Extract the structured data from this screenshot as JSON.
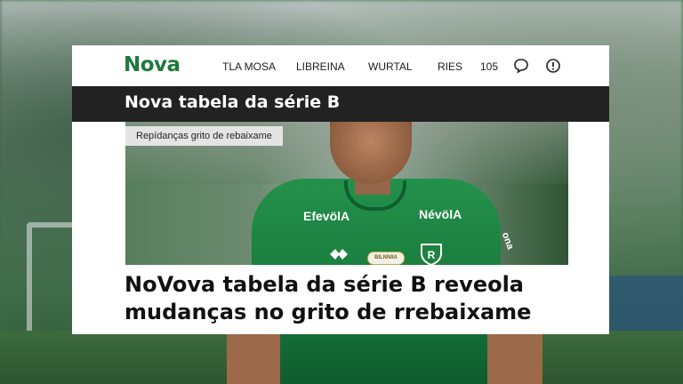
{
  "brand": {
    "logo": "Nova",
    "accent": "#1f7a3c"
  },
  "nav": {
    "items": [
      "TLA MOSA",
      "LIBREINA",
      "WURTAL",
      "RIES",
      "105"
    ],
    "icons": [
      "chat-icon",
      "alert-icon"
    ]
  },
  "section_title": "Nova tabela da série B",
  "tag": "Repídanças grito de rebaixame",
  "hero": {
    "sponsor_left": "EfevölA",
    "sponsor_right": "NévölA",
    "sleeve_text": "ona",
    "badge": "BILNNIIA"
  },
  "headline": {
    "line1": "NoVova tabela da série B reveola",
    "line2": "mudanças no grito de rrebaixame"
  }
}
